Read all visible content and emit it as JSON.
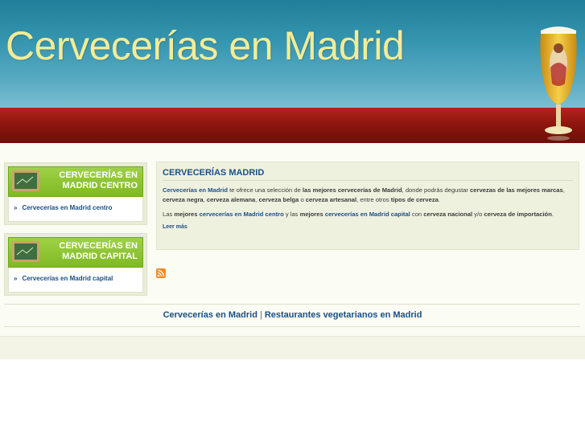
{
  "header": {
    "site_title": "Cervecerías en Madrid"
  },
  "sidebar": {
    "boxes": [
      {
        "title": "CERVECERÍAS EN MADRID CENTRO",
        "link": "Cervecerías en Madrid centro"
      },
      {
        "title": "CERVECERÍAS EN MADRID CAPITAL",
        "link": "Cervecerías en Madrid capital"
      }
    ],
    "bullet": "»"
  },
  "article": {
    "title": "CERVECERÍAS MADRID",
    "p1": {
      "s1": "Cervecerías en Madrid",
      "s2": " te ofrece una selección de ",
      "s3": "las mejores cervecerías de Madrid",
      "s4": ", donde podrás degustar ",
      "s5": "cervezas de las mejores marcas",
      "s6": ", ",
      "s7": "cerveza negra",
      "s8": ", ",
      "s9": "cerveza alemana",
      "s10": ", ",
      "s11": "cerveza belga",
      "s12": " o ",
      "s13": "cerveza artesanal",
      "s14": ", entre otros ",
      "s15": "tipos de cerveza",
      "s16": "."
    },
    "p2": {
      "s1": "Las ",
      "s2": "mejores",
      "s3": " ",
      "s4": "cervecerías en Madrid centro",
      "s5": " y las ",
      "s6": "mejores",
      "s7": " ",
      "s8": "cervecerías en Madrid capital",
      "s9": " con ",
      "s10": "cerveza nacional",
      "s11": " y/o ",
      "s12": "cerveza de importación",
      "s13": "."
    },
    "read_more": "Leer más"
  },
  "icons": {
    "rss": "rss-feed-icon",
    "board": "chalkboard-icon",
    "beer": "beer-glass-icon"
  },
  "footer": {
    "link1": "Cervecerías en Madrid",
    "separator": "|",
    "link2": "Restaurantes vegetarianos en Madrid"
  },
  "colors": {
    "accent_green": "#7fba22",
    "link_blue": "#1a4f86",
    "title_yellow": "#f3ec95",
    "header_red": "#8e160f"
  }
}
